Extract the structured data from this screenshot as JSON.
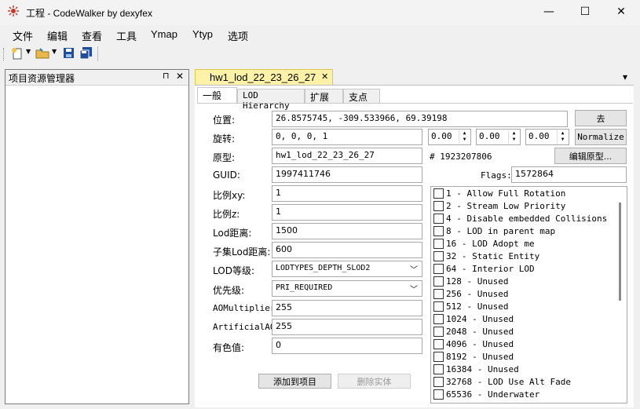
{
  "window": {
    "title": "工程 - CodeWalker by dexyfex",
    "minimize": "—",
    "maximize": "☐",
    "close": "✕"
  },
  "menu": [
    "文件",
    "编辑",
    "查看",
    "工具",
    "Ymap",
    "Ytyp",
    "选项"
  ],
  "left_panel": {
    "title": "项目资源管理器",
    "pin": "⊓",
    "close": "✕"
  },
  "doc_tab": {
    "label": "hw1_lod_22_23_26_27",
    "close": "✕",
    "dropdown": "▾"
  },
  "tabs": [
    "一般",
    "LOD Hierarchy",
    "扩展",
    "支点"
  ],
  "form": {
    "position_label": "位置:",
    "position_value": "26.8575745, -309.533966, 69.39198",
    "go_button": "去",
    "rotation_label": "旋转:",
    "rotation_value": "0, 0, 0, 1",
    "rot_x": "0.00",
    "rot_y": "0.00",
    "rot_z": "0.00",
    "normalize_button": "Normalize",
    "archetype_label": "原型:",
    "archetype_value": "hw1_lod_22_23_26_27",
    "archetype_hash": "# 1923207806",
    "edit_archetype_button": "编辑原型...",
    "guid_label": "GUID:",
    "guid_value": "1997411746",
    "flags_label": "Flags:",
    "flags_value": "1572864",
    "scalexy_label": "比例xy:",
    "scalexy_value": "1",
    "scalez_label": "比例z:",
    "scalez_value": "1",
    "loddist_label": "Lod距离:",
    "loddist_value": "1500",
    "childloddist_label": "子集Lod距离:",
    "childloddist_value": "600",
    "lodlevel_label": "LOD等级:",
    "lodlevel_value": "LODTYPES_DEPTH_SLOD2",
    "priority_label": "优先级:",
    "priority_value": "PRI_REQUIRED",
    "aomult_label": "AOMultiplier:",
    "aomult_value": "255",
    "artao_label": "ArtificialAO:",
    "artao_value": "255",
    "tint_label": "有色值:",
    "tint_value": "0",
    "add_button": "添加到项目",
    "delete_button": "删除实体"
  },
  "flags": [
    "1 - Allow Full Rotation",
    "2 - Stream Low Priority",
    "4 - Disable embedded Collisions",
    "8  - LOD in parent map",
    "16 - LOD Adopt me",
    "32 - Static Entity",
    "64 - Interior LOD",
    "128 - Unused",
    "256 - Unused",
    "512 - Unused",
    "1024 - Unused",
    "2048 - Unused",
    "4096 - Unused",
    "8192 - Unused",
    "16384 - Unused",
    "32768 - LOD Use Alt Fade",
    "65536 - Underwater"
  ],
  "colors": {
    "doc_tab": "#fdf2a7",
    "doc_area": "#f0f0f0"
  }
}
